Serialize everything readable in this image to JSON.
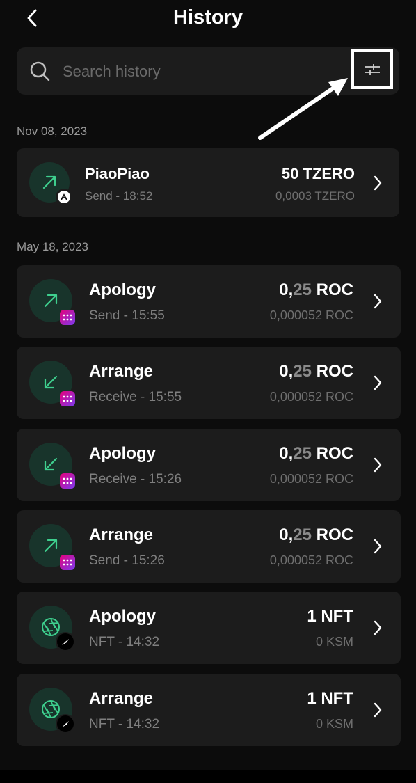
{
  "header": {
    "title": "History",
    "back_icon": "chevron-left-icon"
  },
  "search": {
    "placeholder": "Search history",
    "icon": "search-icon",
    "filter_icon": "sliders-icon"
  },
  "colors": {
    "accent": "#3ecf8e",
    "card_bg": "#1c1c1c",
    "icon_bg": "#18342b",
    "page_bg": "#0c0c0c"
  },
  "groups": [
    {
      "date": "Nov 08, 2023",
      "items": [
        {
          "name": "PiaoPiao",
          "sub": "Send - 18:52",
          "amount_int": "50",
          "amount_dec": "",
          "amount_unit": " TZERO",
          "fee": "0,0003 TZERO",
          "direction": "send",
          "chain": "aleph"
        }
      ]
    },
    {
      "date": "May 18, 2023",
      "items": [
        {
          "name": "Apology",
          "sub": "Send - 15:55",
          "amount_int": "0,",
          "amount_dec": "25",
          "amount_unit": " ROC",
          "fee": "0,000052 ROC",
          "direction": "send",
          "chain": "roc"
        },
        {
          "name": "Arrange",
          "sub": "Receive - 15:55",
          "amount_int": "0,",
          "amount_dec": "25",
          "amount_unit": " ROC",
          "fee": "0,000052 ROC",
          "direction": "receive",
          "chain": "roc"
        },
        {
          "name": "Apology",
          "sub": "Receive - 15:26",
          "amount_int": "0,",
          "amount_dec": "25",
          "amount_unit": " ROC",
          "fee": "0,000052 ROC",
          "direction": "receive",
          "chain": "roc"
        },
        {
          "name": "Arrange",
          "sub": "Send - 15:26",
          "amount_int": "0,",
          "amount_dec": "25",
          "amount_unit": " ROC",
          "fee": "0,000052 ROC",
          "direction": "send",
          "chain": "roc"
        },
        {
          "name": "Apology",
          "sub": "NFT - 14:32",
          "amount_int": "1 NFT",
          "amount_dec": "",
          "amount_unit": "",
          "fee": "0 KSM",
          "direction": "nft",
          "chain": "ksm"
        },
        {
          "name": "Arrange",
          "sub": "NFT - 14:32",
          "amount_int": "1 NFT",
          "amount_dec": "",
          "amount_unit": "",
          "fee": "0 KSM",
          "direction": "nft",
          "chain": "ksm"
        }
      ]
    }
  ]
}
